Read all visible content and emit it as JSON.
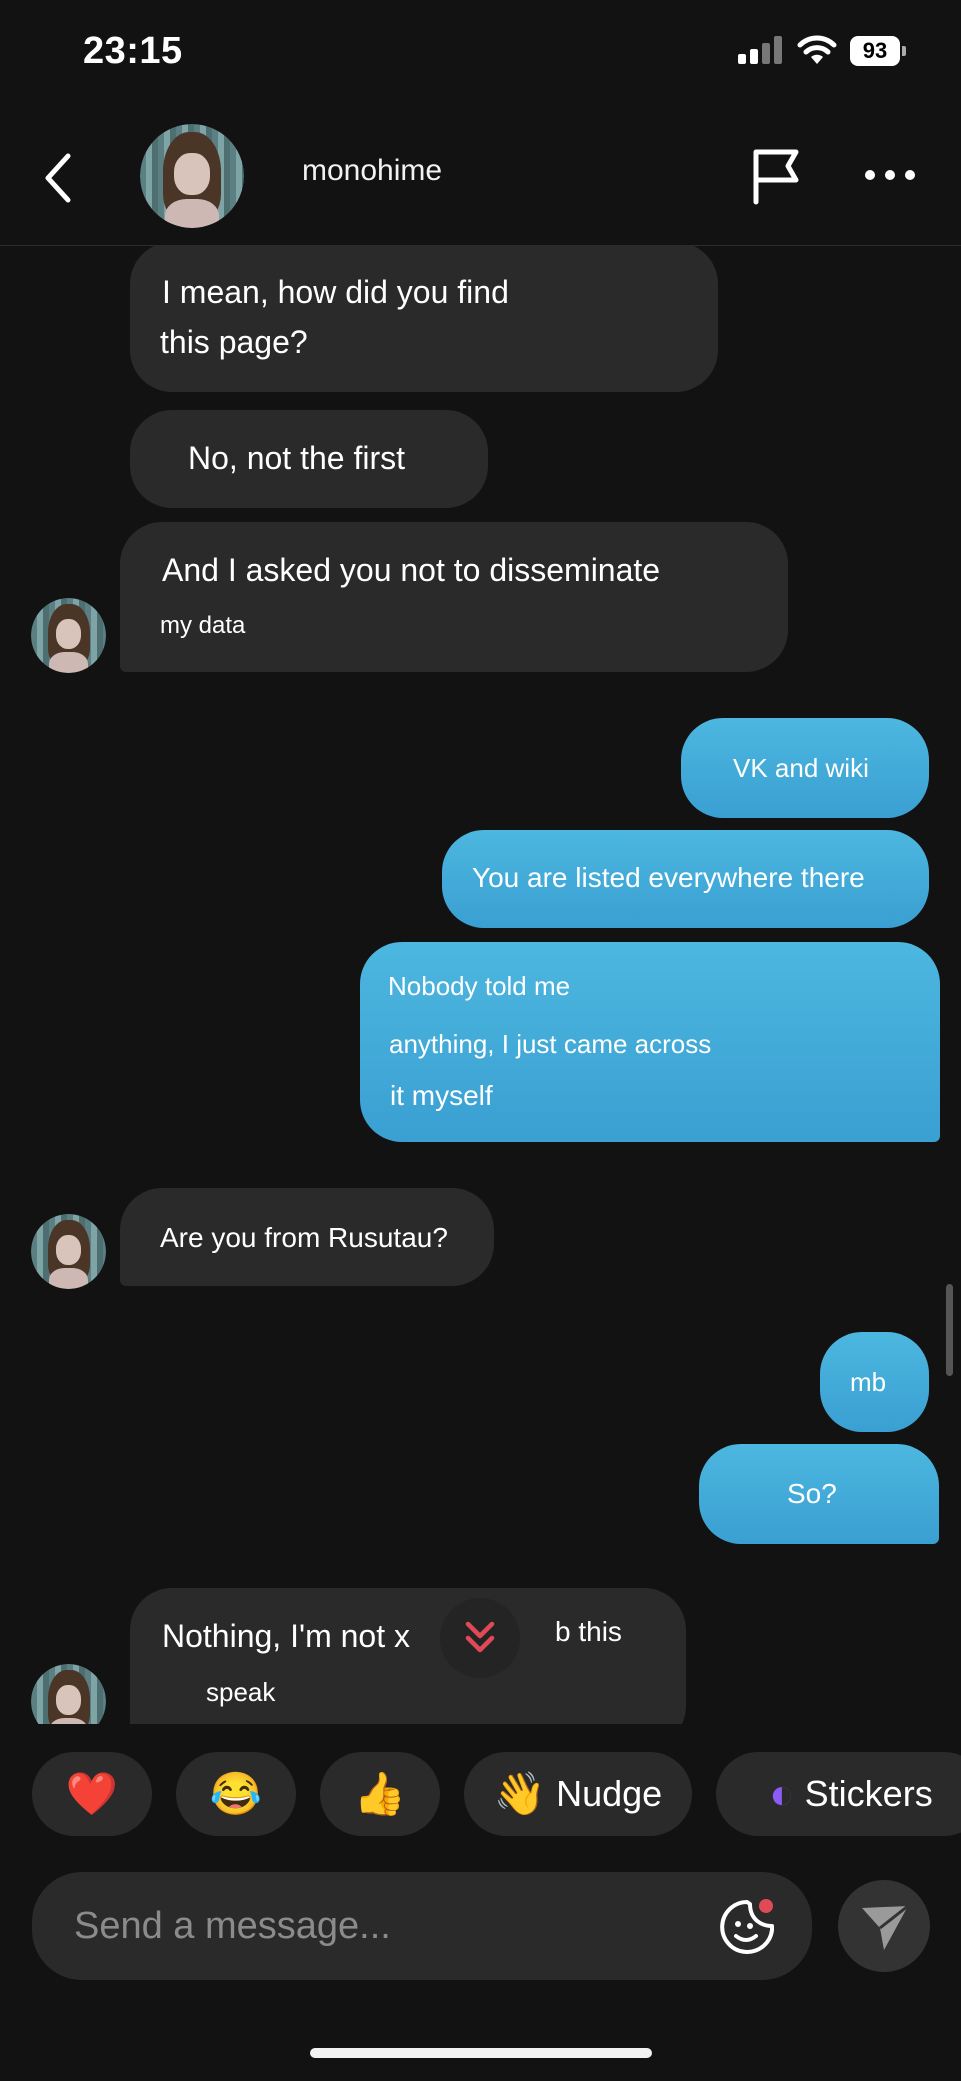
{
  "status_bar": {
    "time": "23:15",
    "battery": "93"
  },
  "header": {
    "username": "monohime"
  },
  "messages": [
    {
      "from": "them",
      "lines": [
        "I mean, how did you find",
        "this page?"
      ]
    },
    {
      "from": "them",
      "lines": [
        "No, not the first"
      ]
    },
    {
      "from": "them",
      "lines": [
        "And I asked you not to disseminate",
        "my data"
      ]
    },
    {
      "from": "me",
      "lines": [
        "VK and wiki"
      ]
    },
    {
      "from": "me",
      "lines": [
        "You are listed everywhere there"
      ]
    },
    {
      "from": "me",
      "lines": [
        "Nobody told me",
        "anything, I just came across",
        "it myself"
      ]
    },
    {
      "from": "them",
      "lines": [
        "Are you from Rusutau?"
      ]
    },
    {
      "from": "me",
      "lines": [
        "mb"
      ]
    },
    {
      "from": "me",
      "lines": [
        "So?"
      ]
    },
    {
      "from": "them",
      "lines": [
        "Nothing, I'm not x",
        "b this",
        "speak"
      ]
    }
  ],
  "reactions": [
    {
      "emoji": "❤️",
      "label": ""
    },
    {
      "emoji": "😂",
      "label": ""
    },
    {
      "emoji": "👍",
      "label": ""
    },
    {
      "emoji": "👋",
      "label": "Nudge"
    },
    {
      "emoji": "◐",
      "label": "Stickers"
    }
  ],
  "composer": {
    "placeholder": "Send a message..."
  },
  "colors": {
    "background": "#121212",
    "incoming": "#2a2a2a",
    "outgoing": "#4cb7df",
    "accent": "#e04a57"
  }
}
